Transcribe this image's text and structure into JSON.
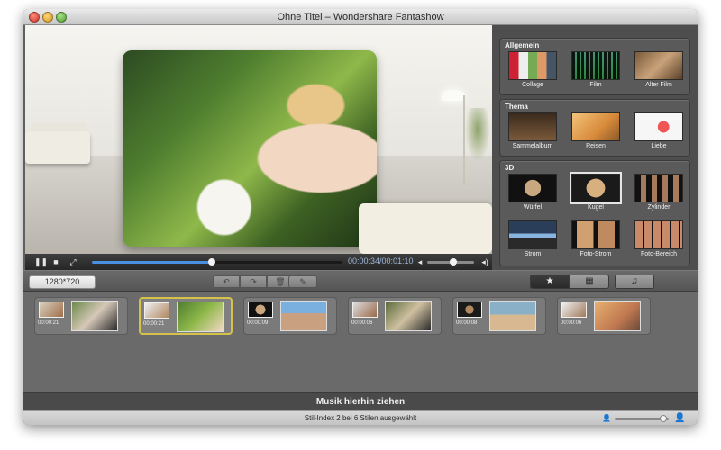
{
  "window": {
    "title": "Ohne Titel – Wondershare Fantashow"
  },
  "player": {
    "progress_fraction": 0.48,
    "timecode": "00:00:34/00:01:10",
    "volume_fraction": 0.55
  },
  "styles": {
    "groups": [
      {
        "title": "Allgemein",
        "items": [
          {
            "label": "Collage",
            "icon": "collage-thumbnail"
          },
          {
            "label": "Film",
            "icon": "film-thumbnail"
          },
          {
            "label": "Alter Film",
            "icon": "alter-film-thumbnail"
          }
        ]
      },
      {
        "title": "Thema",
        "items": [
          {
            "label": "Sammelalbum",
            "icon": "sammelalbum-thumbnail"
          },
          {
            "label": "Reisen",
            "icon": "reisen-thumbnail"
          },
          {
            "label": "Liebe",
            "icon": "liebe-thumbnail"
          }
        ]
      },
      {
        "title": "3D",
        "items": [
          {
            "label": "Würfel",
            "icon": "wuerfel-thumbnail"
          },
          {
            "label": "Kugel",
            "icon": "kugel-thumbnail",
            "selected": true
          },
          {
            "label": "Zylinder",
            "icon": "zylinder-thumbnail"
          },
          {
            "label": "Strom",
            "icon": "strom-thumbnail"
          },
          {
            "label": "Foto-Strom",
            "icon": "foto-strom-thumbnail"
          },
          {
            "label": "Foto-Bereich",
            "icon": "foto-bereich-thumbnail"
          }
        ]
      }
    ]
  },
  "toolbar": {
    "resolution": "1280*720",
    "rotate_left_icon": "rotate-left-icon",
    "rotate_right_icon": "rotate-right-icon",
    "delete_icon": "trash-icon",
    "edit_icon": "pencil-icon",
    "segments": [
      "star-icon",
      "film-strip-icon",
      "music-icon"
    ]
  },
  "timeline": {
    "clips": [
      {
        "transition_duration": "00:00:21",
        "selected": false
      },
      {
        "transition_duration": "00:00:21",
        "selected": true
      },
      {
        "transition_duration": "00:00:09",
        "selected": false
      },
      {
        "transition_duration": "00:00:06",
        "selected": false
      },
      {
        "transition_duration": "00:00:08",
        "selected": false
      },
      {
        "transition_duration": "00:00:06",
        "selected": false
      }
    ]
  },
  "music": {
    "drop_label": "Musik hierhin ziehen"
  },
  "status": {
    "text": "Stil-Index 2 bei 6 Stilen ausgewählt",
    "zoom_fraction": 0.9
  },
  "colors": {
    "accent_blue": "#4a90e2",
    "selection_yellow": "#d6c24b",
    "panel_gray": "#5a5a5a",
    "timecode_blue": "#9fb6d8"
  }
}
